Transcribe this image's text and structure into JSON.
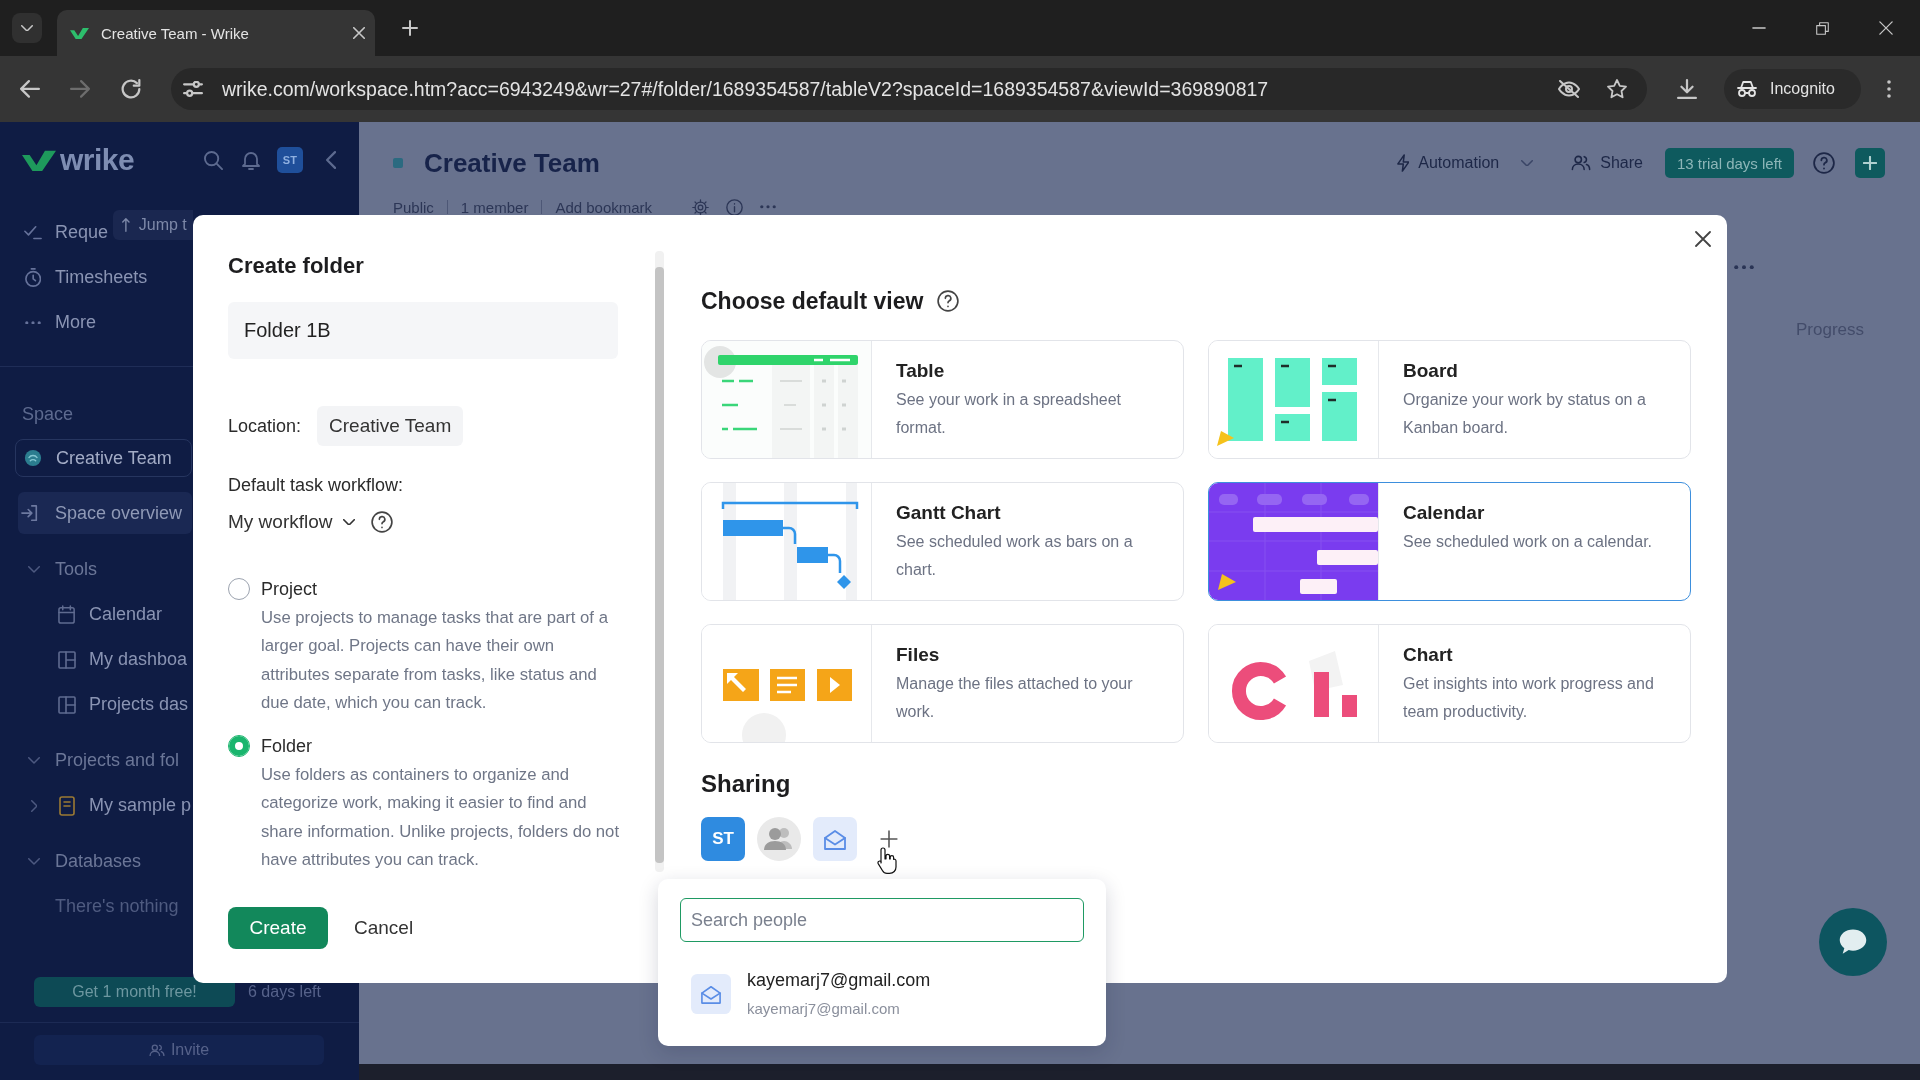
{
  "browser": {
    "tab": {
      "title": "Creative Team - Wrike"
    },
    "url": "wrike.com/workspace.htm?acc=6943249&wr=27#/folder/1689354587/tableV2?spaceId=1689354587&viewId=369890817",
    "profile": "Incognito"
  },
  "sidebar": {
    "logo": "wrike",
    "avatar": "ST",
    "jump": "Jump t",
    "top_items": [
      {
        "kind": "requests",
        "label": "Reque"
      },
      {
        "kind": "timesheets",
        "label": "Timesheets"
      },
      {
        "kind": "more",
        "label": "More"
      }
    ],
    "space": {
      "heading": "Space",
      "name": "Creative Team",
      "links": [
        {
          "label": "Space overview",
          "selected": true
        }
      ]
    },
    "tree": [
      {
        "label": "Tools",
        "expanded": true,
        "children": [
          {
            "kind": "calendar",
            "label": "Calendar"
          },
          {
            "kind": "dashboard",
            "label": "My dashboa"
          },
          {
            "kind": "dashboard",
            "label": "Projects das"
          }
        ]
      },
      {
        "label": "Projects and fol",
        "expanded": true,
        "children": [
          {
            "kind": "project",
            "label": "My sample p",
            "expanded": false
          }
        ]
      },
      {
        "label": "Databases",
        "expanded": true,
        "children": [
          {
            "kind": "note",
            "label": "There's nothing"
          }
        ]
      }
    ],
    "promo": {
      "button": "Get 1 month free!",
      "note": "6 days left"
    },
    "invite": "Invite"
  },
  "header": {
    "title": "Creative Team",
    "meta": [
      "Public",
      "1 member",
      "Add bookmark"
    ],
    "automation": "Automation",
    "share": "Share",
    "trial": "13 trial days left"
  },
  "table": {
    "column_header": "Progress"
  },
  "modal": {
    "title": "Create folder",
    "name": "Folder 1B",
    "location": {
      "label": "Location:",
      "value": "Creative Team"
    },
    "workflow": {
      "label": "Default task workflow:",
      "value": "My workflow"
    },
    "types": [
      {
        "label": "Project",
        "description": "Use projects to manage tasks that are part of a larger goal. Projects can have their own attributes separate from tasks, like status and due date, which you can track.",
        "selected": false
      },
      {
        "label": "Folder",
        "description": "Use folders as containers to organize and categorize work, making it easier to find and share information. Unlike projects, folders do not have attributes you can track.",
        "selected": true
      }
    ],
    "actions": [
      {
        "kind": "primary",
        "label": "Create"
      },
      {
        "kind": "secondary",
        "label": "Cancel"
      }
    ],
    "views_heading": "Choose default view",
    "views": [
      {
        "kind": "table",
        "title": "Table",
        "description": "See your work in a spreadsheet format.",
        "selected": false
      },
      {
        "kind": "board",
        "title": "Board",
        "description": "Organize your work by status on a Kanban board.",
        "selected": false
      },
      {
        "kind": "gantt",
        "title": "Gantt Chart",
        "description": "See scheduled work as bars on a chart.",
        "selected": false
      },
      {
        "kind": "calendar",
        "title": "Calendar",
        "description": "See scheduled work on a calendar.",
        "selected": true
      },
      {
        "kind": "files",
        "title": "Files",
        "description": "Manage the files attached to your work.",
        "selected": false
      },
      {
        "kind": "chart",
        "title": "Chart",
        "description": "Get insights into work progress and team productivity.",
        "selected": false
      }
    ],
    "sharing": {
      "heading": "Sharing",
      "members": [
        {
          "kind": "initials",
          "label": "ST"
        },
        {
          "kind": "group"
        },
        {
          "kind": "email"
        }
      ]
    },
    "people_search": {
      "placeholder": "Search people",
      "results": [
        {
          "name": "kayemarj7@gmail.com",
          "email": "kayemarj7@gmail.com"
        }
      ]
    }
  }
}
